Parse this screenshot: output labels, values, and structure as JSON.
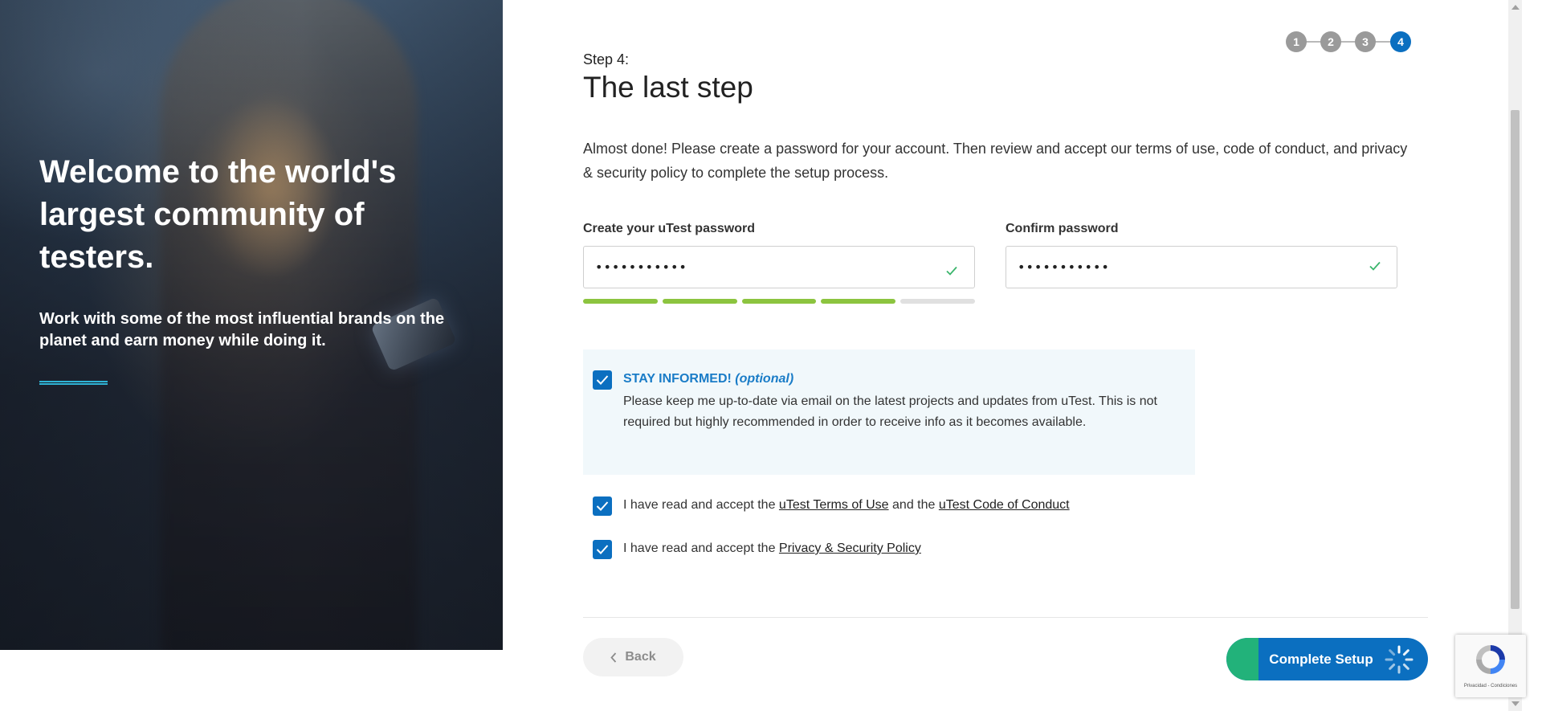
{
  "hero": {
    "title": "Welcome to the world's largest community of testers.",
    "subtitle": "Work with some of the most influential brands on the planet and earn money while doing it."
  },
  "stepper": {
    "steps": [
      "1",
      "2",
      "3",
      "4"
    ],
    "current": 4
  },
  "header": {
    "step_label": "Step 4:",
    "title": "The last step"
  },
  "intro": "Almost done! Please create a password for your account. Then review and accept our terms of use, code of conduct, and privacy & security policy to complete the setup process.",
  "password": {
    "label": "Create your uTest password",
    "value": "•••••••••••",
    "valid_icon": "check-icon",
    "strength": {
      "segments": 5,
      "filled": 4
    }
  },
  "confirm_password": {
    "label": "Confirm password",
    "value": "•••••••••••",
    "valid_icon": "check-icon"
  },
  "stay_informed": {
    "checked": true,
    "title": "STAY INFORMED!",
    "optional": "(optional)",
    "text": "Please keep me up-to-date via email on the latest projects and updates from uTest. This is not required but highly recommended in order to receive info as it becomes available."
  },
  "terms": {
    "checked": true,
    "prefix": "I have read and accept the",
    "terms_link": "uTest Terms of Use",
    "middle": "and the",
    "conduct_link": "uTest Code of Conduct"
  },
  "privacy": {
    "checked": true,
    "prefix": "I have read and accept the",
    "link": "Privacy & Security Policy"
  },
  "actions": {
    "back_label": "Back",
    "submit_label": "Complete Setup"
  },
  "recaptcha": {
    "text": "Privacidad - Condiciones"
  },
  "colors": {
    "primary": "#0b6fc0",
    "success": "#22b27a",
    "strength": "#8cc43f",
    "info_bg": "#f1f8fb"
  }
}
